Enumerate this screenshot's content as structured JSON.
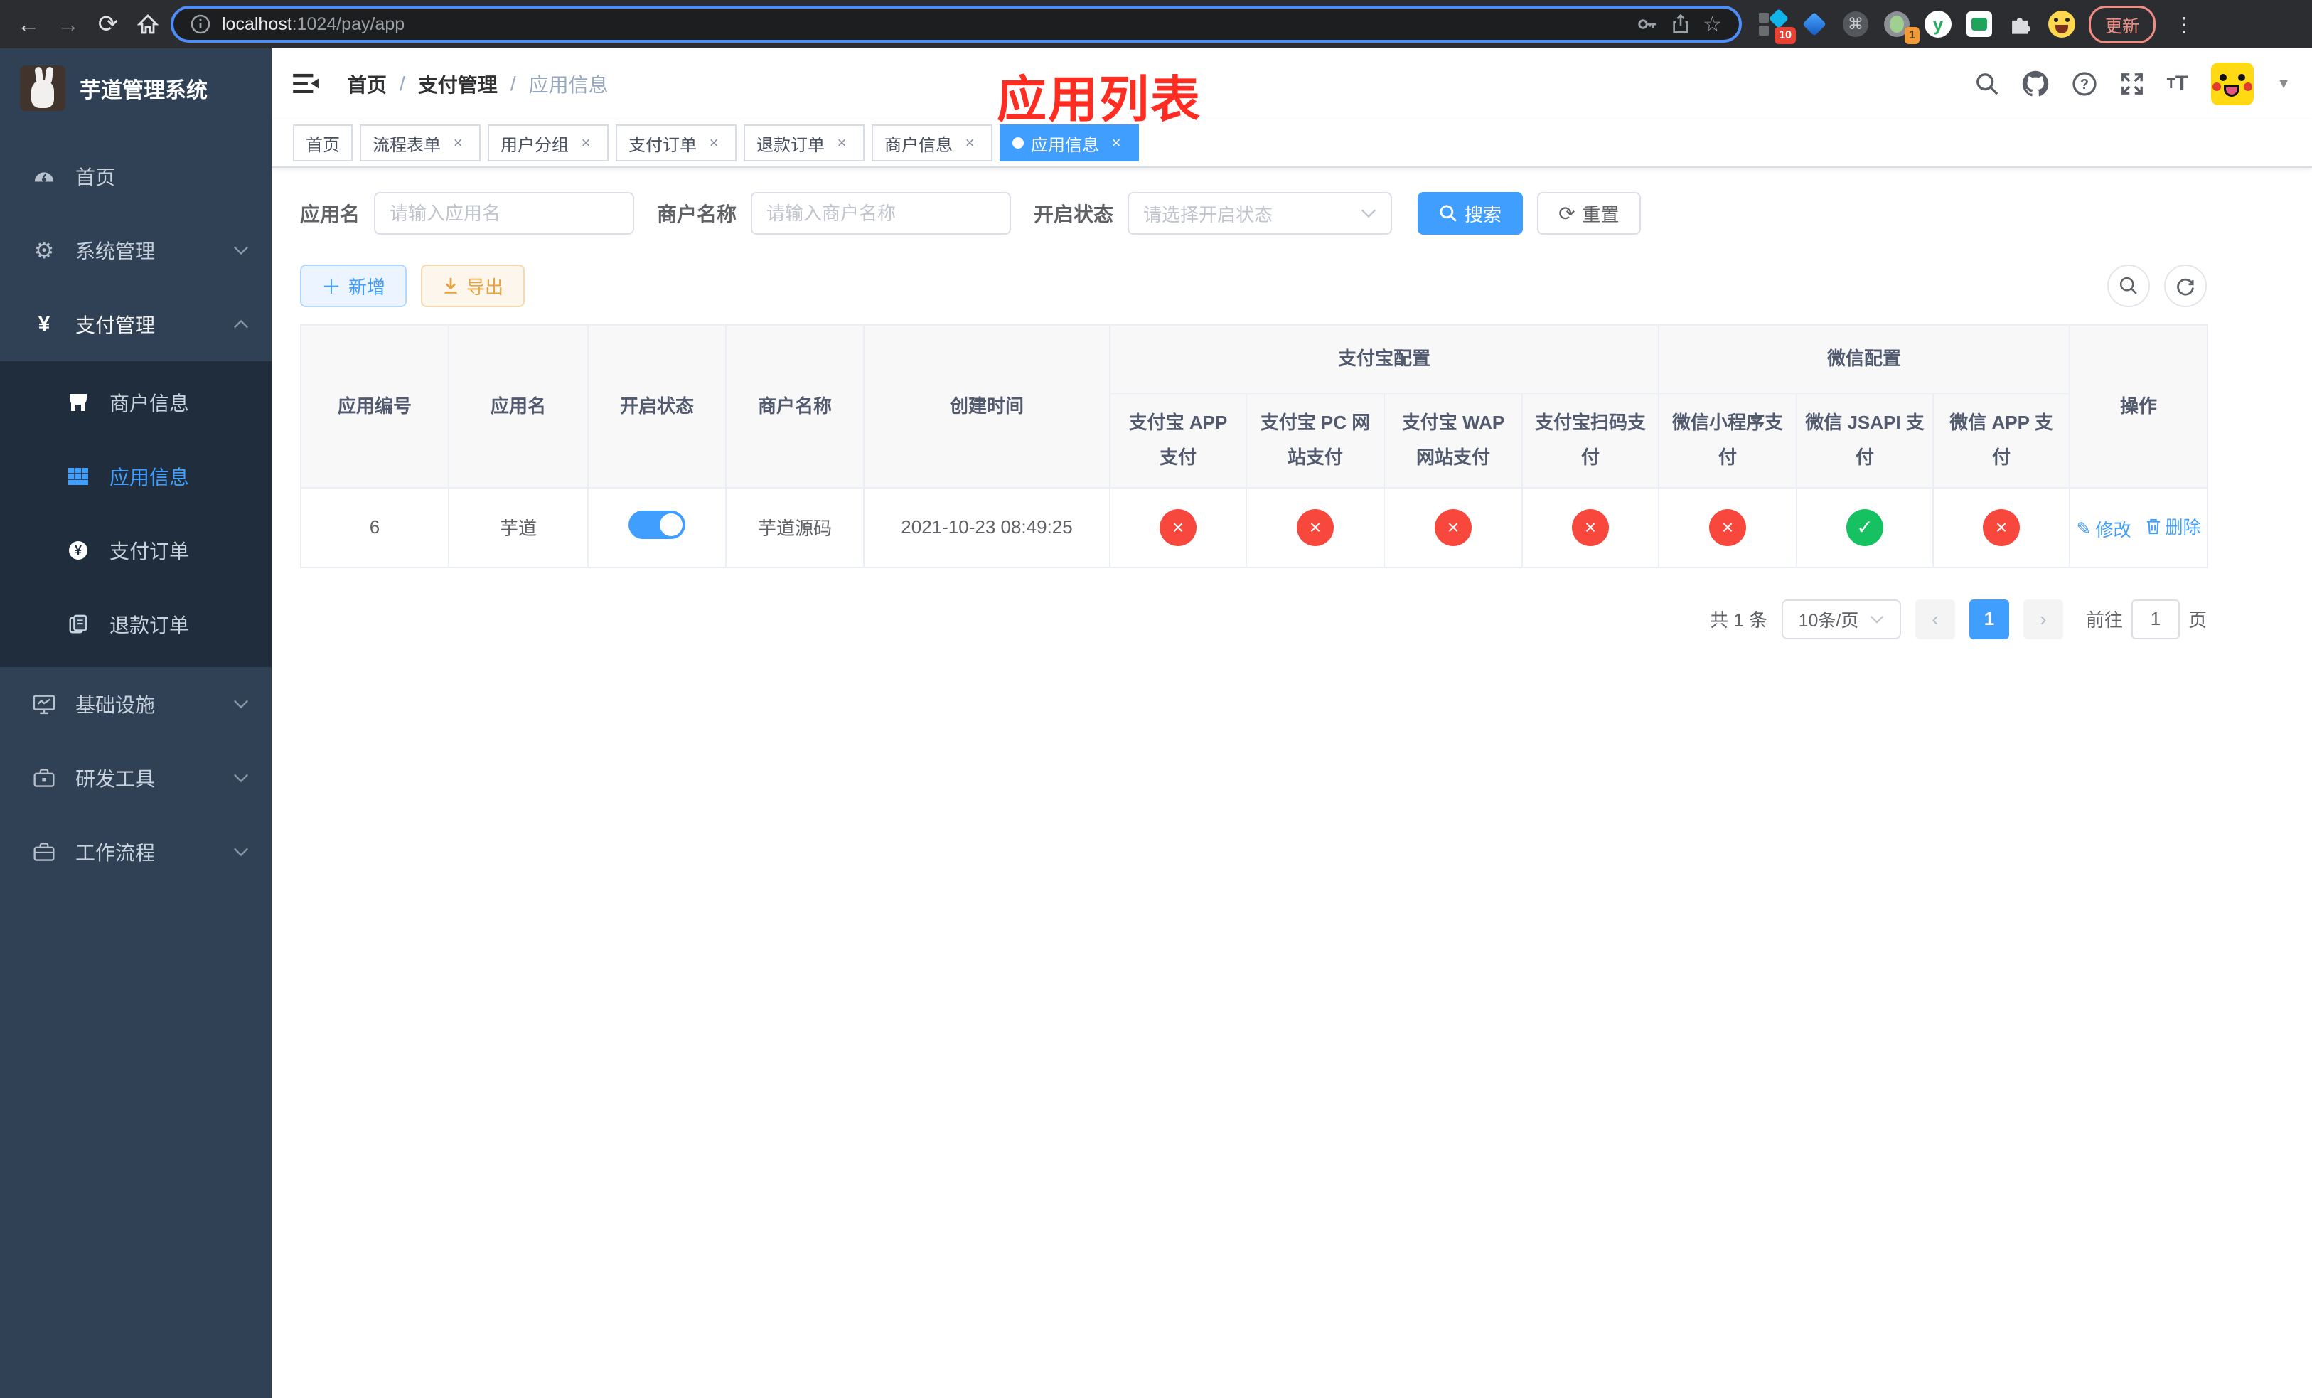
{
  "browser": {
    "url_host": "localhost",
    "url_rest": ":1024/pay/app",
    "update_label": "更新",
    "extension_badge_1": "10",
    "extension_badge_2": "1",
    "y_extension_letter": "y"
  },
  "annotation": {
    "title": "应用列表",
    "color": "#fe2c21"
  },
  "sidebar": {
    "title": "芋道管理系统",
    "menu_top": [
      {
        "label": "首页"
      },
      {
        "label": "系统管理"
      },
      {
        "label": "支付管理"
      }
    ],
    "submenu": [
      {
        "label": "商户信息"
      },
      {
        "label": "应用信息"
      },
      {
        "label": "支付订单"
      },
      {
        "label": "退款订单"
      }
    ],
    "menu_bottom": [
      {
        "label": "基础设施"
      },
      {
        "label": "研发工具"
      },
      {
        "label": "工作流程"
      }
    ]
  },
  "breadcrumb": {
    "items": [
      "首页",
      "支付管理",
      "应用信息"
    ]
  },
  "tabs": [
    {
      "label": "首页"
    },
    {
      "label": "流程表单"
    },
    {
      "label": "用户分组"
    },
    {
      "label": "支付订单"
    },
    {
      "label": "退款订单"
    },
    {
      "label": "商户信息"
    },
    {
      "label": "应用信息"
    }
  ],
  "filters": {
    "app_name_label": "应用名",
    "app_name_placeholder": "请输入应用名",
    "merchant_label": "商户名称",
    "merchant_placeholder": "请输入商户名称",
    "status_label": "开启状态",
    "status_placeholder": "请选择开启状态",
    "search_label": "搜索",
    "reset_label": "重置"
  },
  "toolbar": {
    "add_label": "新增",
    "export_label": "导出"
  },
  "table": {
    "columns": [
      "应用编号",
      "应用名",
      "开启状态",
      "商户名称",
      "创建时间"
    ],
    "groups": {
      "alipay": "支付宝配置",
      "wechat": "微信配置",
      "actions": "操作"
    },
    "sub_columns": [
      "支付宝 APP 支付",
      "支付宝 PC 网站支付",
      "支付宝 WAP 网站支付",
      "支付宝扫码支付",
      "微信小程序支付",
      "微信 JSAPI 支付",
      "微信 APP 支付"
    ],
    "row": {
      "id": "6",
      "name": "芋道",
      "enabled": true,
      "merchant": "芋道源码",
      "created_at": "2021-10-23 08:49:25",
      "statuses": [
        {
          "name": "alipay-app-pay",
          "enabled": false,
          "symbol": "×",
          "color": "#f8483e"
        },
        {
          "name": "alipay-pc-pay",
          "enabled": false,
          "symbol": "×",
          "color": "#f8483e"
        },
        {
          "name": "alipay-wap-pay",
          "enabled": false,
          "symbol": "×",
          "color": "#f8483e"
        },
        {
          "name": "alipay-qr-pay",
          "enabled": false,
          "symbol": "×",
          "color": "#f8483e"
        },
        {
          "name": "wechat-lite-pay",
          "enabled": false,
          "symbol": "×",
          "color": "#f8483e"
        },
        {
          "name": "wechat-jsapi-pay",
          "enabled": true,
          "symbol": "✓",
          "color": "#15c160"
        },
        {
          "name": "wechat-app-pay",
          "enabled": false,
          "symbol": "×",
          "color": "#f8483e"
        }
      ],
      "edit_label": "修改",
      "delete_label": "删除"
    }
  },
  "pagination": {
    "total": "共 1 条",
    "page_size": "10条/页",
    "current_page": "1",
    "goto_label": "前往",
    "goto_value": "1",
    "page_unit": "页"
  },
  "colors": {
    "primary": "#409EFF",
    "sidebar_bg": "#304156",
    "submenu_bg": "#1f2d3d"
  }
}
